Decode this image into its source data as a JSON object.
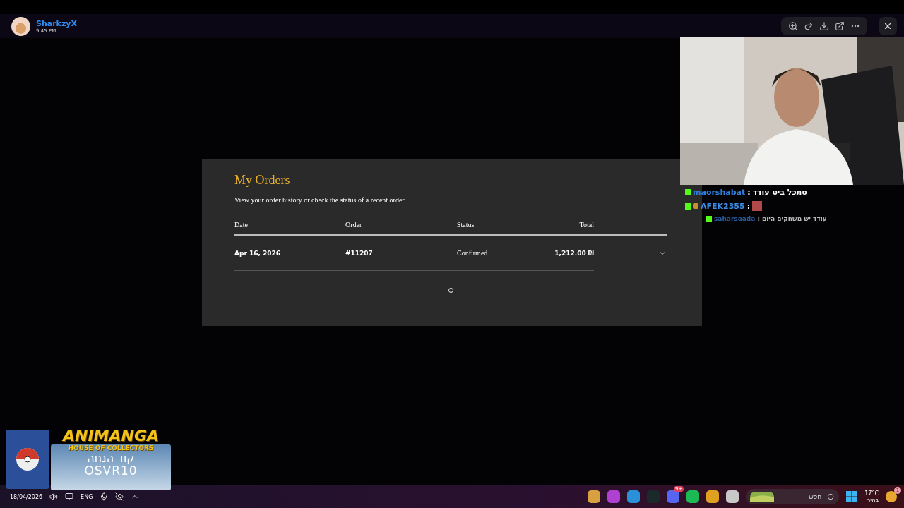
{
  "viewer": {
    "user": "SharkzyX",
    "time": "9:45 PM"
  },
  "modal": {
    "title": "My Orders",
    "subtitle": "View your order history or check the status of a recent order.",
    "columns": [
      "Date",
      "Order",
      "Status",
      "Total"
    ],
    "rows": [
      {
        "date": "Apr 16, 2026",
        "order": "#11207",
        "status": "Confirmed",
        "total": "1,212.00",
        "currency": "₪",
        "expanded": false
      }
    ]
  },
  "chat": [
    {
      "kind": "normal",
      "user": "maorshabat",
      "color": "#2f7fe0",
      "separator": ":",
      "message": "סתכל ביט עודד"
    },
    {
      "kind": "emote",
      "user": "AFEK2355",
      "color": "#3b8fea",
      "separator": ":"
    },
    {
      "kind": "faded",
      "user": "saharsaada",
      "color": "#2a5a9c",
      "separator": ":",
      "message": "עודד יש משחקים היום"
    }
  ],
  "ad": {
    "brand": "ANIMANGA",
    "tagline": "HOUSE OF COLLECTORS",
    "code_label": "קוד הנחה",
    "code": "OSVR10"
  },
  "taskbar": {
    "date": "18/04/2026",
    "language": "ENG",
    "discord_badge": "9+",
    "search_placeholder": "חפש",
    "temperature": "17°C",
    "weather": "בהיר",
    "notification_count": "1"
  }
}
